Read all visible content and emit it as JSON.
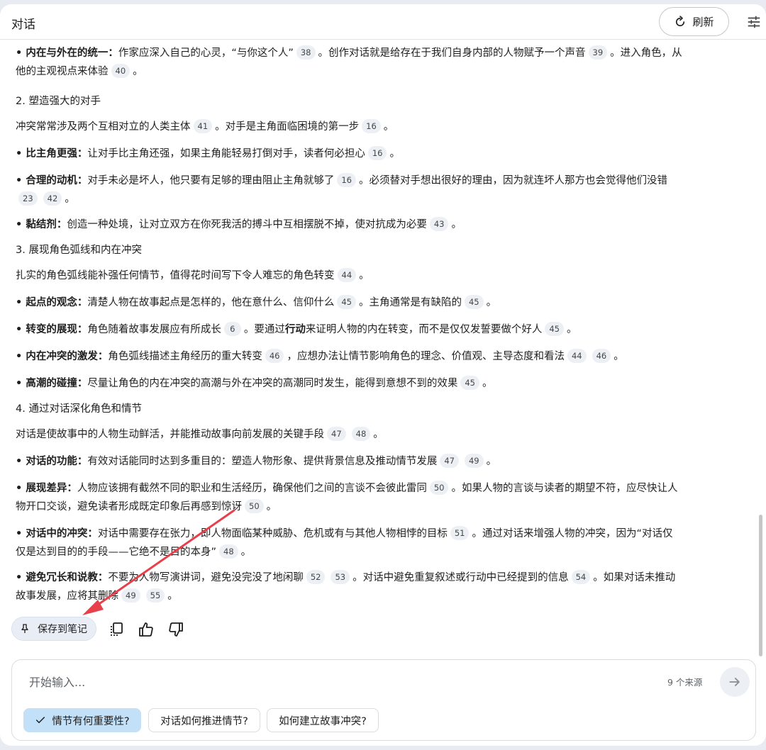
{
  "header": {
    "title": "对话",
    "refresh_label": "刷新"
  },
  "content": {
    "p0": {
      "bold": "• 内在与外在的统一：",
      "text": "作家应深入自己的心灵，“与你这个人”",
      "c1": "38",
      "text2": "。创作对话就是给存在于我们自身内部的人物赋予一个声音",
      "c2": "39",
      "text3": "。进入角色，从他的主观视点来体验",
      "c3": "40",
      "text4": "。"
    },
    "h2": "2. 塑造强大的对手",
    "p1": {
      "text": "冲突常常涉及两个互相对立的人类主体",
      "c1": "41",
      "text2": "。对手是主角面临困境的第一步",
      "c2": "16",
      "text3": "。"
    },
    "p2": {
      "bold": "• 比主角更强：",
      "text": "让对手比主角还强，如果主角能轻易打倒对手，读者何必担心",
      "c1": "16",
      "text2": "。"
    },
    "p3": {
      "bold": "• 合理的动机：",
      "text": "对手未必是坏人，他只要有足够的理由阻止主角就够了",
      "c1": "16",
      "text2": "。必须替对手想出很好的理由，因为就连坏人那方也会觉得他们没错",
      "c2": "23",
      "c3": "42",
      "text3": "。"
    },
    "p4": {
      "bold": "• 黏结剂：",
      "text": "创造一种处境，让对立双方在你死我活的搏斗中互相摆脱不掉，使对抗成为必要",
      "c1": "43",
      "text2": "。"
    },
    "h3": "3. 展现角色弧线和内在冲突",
    "p5": {
      "text": "扎实的角色弧线能补强任何情节，值得花时间写下令人难忘的角色转变",
      "c1": "44",
      "text2": "。"
    },
    "p6": {
      "bold": "• 起点的观念：",
      "text": "清楚人物在故事起点是怎样的，他在意什么、信仰什么",
      "c1": "45",
      "text2": "。主角通常是有缺陷的",
      "c2": "45",
      "text3": "。"
    },
    "p7": {
      "bold": "• 转变的展现：",
      "text": "角色随着故事发展应有所成长",
      "c1": "6",
      "text2": "。要通过",
      "bold2": "行动",
      "text3": "来证明人物的内在转变，而不是仅仅发誓要做个好人",
      "c2": "45",
      "text4": "。"
    },
    "p8": {
      "bold": "• 内在冲突的激发：",
      "text": "角色弧线描述主角经历的重大转变",
      "c1": "46",
      "text2": "，应想办法让情节影响角色的理念、价值观、主导态度和看法",
      "c2": "44",
      "c3": "46",
      "text3": "。"
    },
    "p9": {
      "bold": "• 高潮的碰撞：",
      "text": "尽量让角色的内在冲突的高潮与外在冲突的高潮同时发生，能得到意想不到的效果",
      "c1": "45",
      "text2": "。"
    },
    "h4": "4. 通过对话深化角色和情节",
    "p10": {
      "text": "对话是使故事中的人物生动鲜活，并能推动故事向前发展的关键手段",
      "c1": "47",
      "c2": "48",
      "text2": "。"
    },
    "p11": {
      "bold": "• 对话的功能：",
      "text": "有效对话能同时达到多重目的：塑造人物形象、提供背景信息及推动情节发展",
      "c1": "47",
      "c2": "49",
      "text2": "。"
    },
    "p12": {
      "bold": "• 展现差异：",
      "text": "人物应该拥有截然不同的职业和生活经历，确保他们之间的言谈不会彼此雷同",
      "c1": "50",
      "text2": "。如果人物的言谈与读者的期望不符，应尽快让人物开口交谈，避免读者形成既定印象后再感到惊讶",
      "c2": "50",
      "text3": "。"
    },
    "p13": {
      "bold": "• 对话中的冲突：",
      "text": "对话中需要存在张力，即人物面临某种威胁、危机或有与其他人物相悖的目标",
      "c1": "51",
      "text2": "。通过对话来增强人物的冲突，因为“对话仅仅是达到目的的手段——它绝不是目的本身”",
      "c2": "48",
      "text3": "。"
    },
    "p14": {
      "bold": "• 避免冗长和说教：",
      "text": "不要为人物写演讲词，避免没完没了地闲聊",
      "c1": "52",
      "c2": "53",
      "text2": "。对话中避免重复叙述或行动中已经提到的信息",
      "c3": "54",
      "text3": "。如果对话未推动故事发展，应将其删除",
      "c4": "49",
      "c5": "55",
      "text4": "。"
    }
  },
  "actions": {
    "save_label": "保存到笔记"
  },
  "composer": {
    "placeholder": "开始输入...",
    "sources": "9 个来源",
    "chips": [
      "情节有何重要性?",
      "对话如何推进情节?",
      "如何建立故事冲突?"
    ]
  },
  "colors": {
    "accent_chip": "#c2e0f8",
    "annotation_arrow": "#e8404a"
  }
}
